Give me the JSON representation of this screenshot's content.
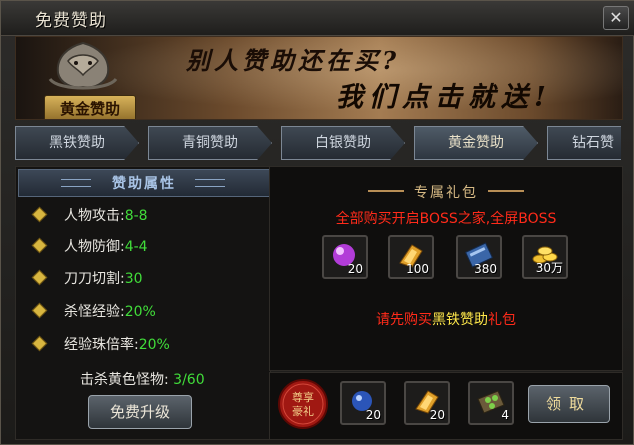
{
  "window": {
    "title": "免费赞助",
    "close_glyph": "✕"
  },
  "banner": {
    "badge_label": "黄金赞助",
    "slogan_line1": "别人赞助还在买?",
    "slogan_line2": "我们点击就送!"
  },
  "tabs": [
    {
      "label": "黑铁赞助",
      "active": false
    },
    {
      "label": "青铜赞助",
      "active": false
    },
    {
      "label": "白银赞助",
      "active": false
    },
    {
      "label": "黄金赞助",
      "active": true
    },
    {
      "label": "钻石赞",
      "active": false
    }
  ],
  "attributes": {
    "header": "赞助属性",
    "items": [
      {
        "label": "人物攻击:",
        "value": "8-8"
      },
      {
        "label": "人物防御:",
        "value": "4-4"
      },
      {
        "label": "刀刀切割:",
        "value": "30"
      },
      {
        "label": "杀怪经验:",
        "value": "20%"
      },
      {
        "label": "经验珠倍率:",
        "value": "20%"
      }
    ],
    "kill_label": "击杀黄色怪物:",
    "kill_value": "3/60",
    "upgrade_label": "免费升级"
  },
  "gift": {
    "header": "专属礼包",
    "description": "全部购买开启BOSS之家,全屏BOSS",
    "items": [
      {
        "icon": "purple-orb-icon",
        "count": "20"
      },
      {
        "icon": "gold-ingot-icon",
        "count": "100"
      },
      {
        "icon": "blue-book-icon",
        "count": "380"
      },
      {
        "icon": "gold-coins-icon",
        "count": "30万"
      }
    ],
    "notice_prefix": "请先购买",
    "notice_highlight": "黑铁赞助",
    "notice_suffix": "礼包"
  },
  "reward": {
    "seal_line1": "尊享",
    "seal_line2": "豪礼",
    "items": [
      {
        "icon": "blue-orb-icon",
        "count": "20"
      },
      {
        "icon": "gold-ingot-icon",
        "count": "20"
      },
      {
        "icon": "green-gem-bag-icon",
        "count": "4"
      }
    ],
    "claim_label": "领取"
  },
  "colors": {
    "value_green": "#41dd3a",
    "notice_red": "#ff2b1a",
    "notice_yellow": "#ffe84a",
    "gold": "#d6b984"
  }
}
